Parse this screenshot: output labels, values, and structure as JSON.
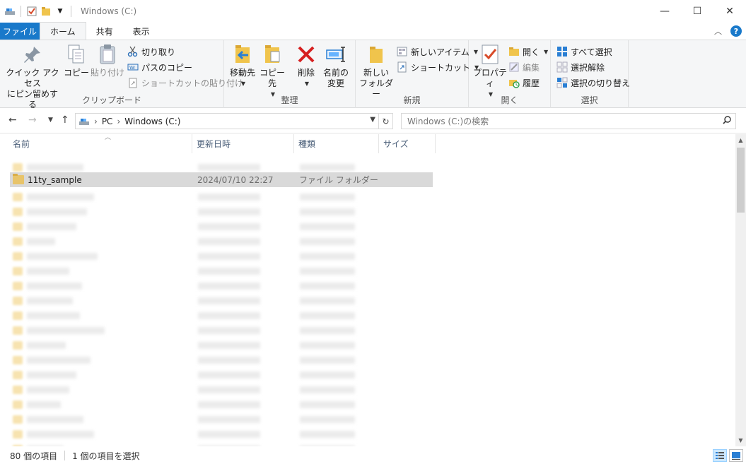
{
  "window": {
    "title": "Windows (C:)",
    "minimize": "—",
    "maximize": "☐",
    "close": "✕"
  },
  "tabs": [
    {
      "label": "ファイル"
    },
    {
      "label": "ホーム"
    },
    {
      "label": "共有"
    },
    {
      "label": "表示"
    }
  ],
  "ribbon": {
    "clipboard": {
      "label": "クリップボード",
      "pin_line1": "クイック アクセス",
      "pin_line2": "にピン留めする",
      "copy": "コピー",
      "paste": "貼り付け",
      "cut": "切り取り",
      "copy_path": "パスのコピー",
      "paste_shortcut": "ショートカットの貼り付け"
    },
    "organize": {
      "label": "整理",
      "move_to": "移動先",
      "copy_to": "コピー先",
      "delete": "削除",
      "rename_line1": "名前の",
      "rename_line2": "変更"
    },
    "new": {
      "label": "新規",
      "new_folder_line1": "新しい",
      "new_folder_line2": "フォルダー",
      "new_item": "新しいアイテム",
      "shortcut": "ショートカット"
    },
    "open": {
      "label": "開く",
      "properties": "プロパティ",
      "open": "開く",
      "edit": "編集",
      "history": "履歴"
    },
    "select": {
      "label": "選択",
      "select_all": "すべて選択",
      "select_none": "選択解除",
      "invert": "選択の切り替え"
    }
  },
  "address": {
    "crumbs": [
      "PC",
      "Windows (C:)"
    ],
    "search_placeholder": "Windows (C:)の検索"
  },
  "columns": {
    "name": "名前",
    "modified": "更新日時",
    "type": "種類",
    "size": "サイズ"
  },
  "selected_item": {
    "name": "11ty_sample",
    "modified": "2024/07/10 22:27",
    "type": "ファイル フォルダー"
  },
  "status": {
    "count": "80 個の項目",
    "selected": "1 個の項目を選択"
  },
  "colors": {
    "accent": "#1979ca",
    "selected_row": "#d9d9d9",
    "folder": "#e8c46a"
  }
}
